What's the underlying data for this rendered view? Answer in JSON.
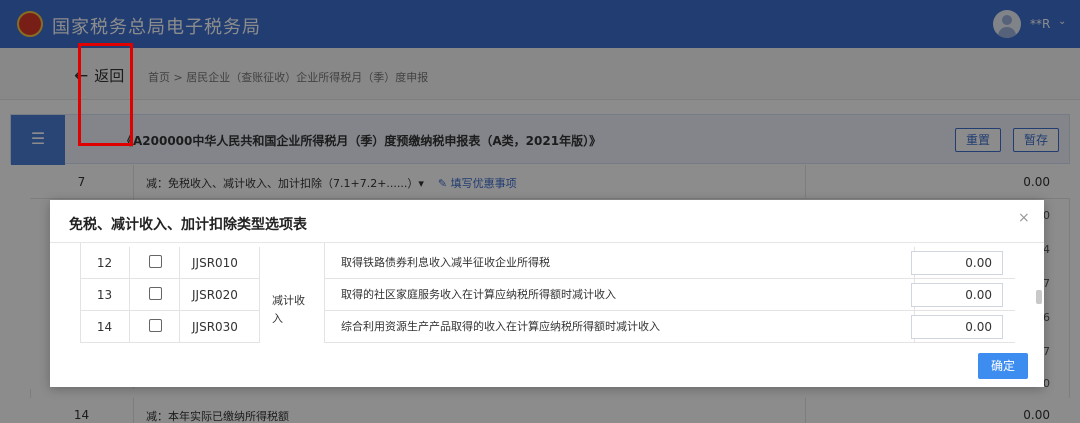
{
  "header": {
    "brand": "国家税务总局电子税务局",
    "user": "**R",
    "logo_icon": "tax-emblem-icon",
    "avatar_icon": "user-avatar-icon",
    "caret": "⌄"
  },
  "subnav": {
    "back_label": "返回",
    "back_icon": "←",
    "breadcrumb": "首页 > 居民企业（查账征收）企业所得税月（季）度申报"
  },
  "form": {
    "menu_icon": "☰",
    "title": "《A200000中华人民共和国企业所得税月（季）度预缴纳税申报表（A类，2021年版）》",
    "reset_label": "重置",
    "save_label": "暂存"
  },
  "background_rows": [
    {
      "no": "7",
      "desc": "减：免税收入、减计收入、加计扣除（7.1+7.2+......）▾",
      "link": "填写优惠事项",
      "value": "0.00"
    },
    {
      "no": "14",
      "desc": "减：本年实际已缴纳所得税额",
      "value": "0.00"
    }
  ],
  "edge_digits": [
    "0",
    "4",
    "7",
    "6",
    "7",
    "0"
  ],
  "modal": {
    "title": "免税、减计收入、加计扣除类型选项表",
    "close_icon": "×",
    "category": "减计收入",
    "rows": [
      {
        "no": "12",
        "code": "JJSR010",
        "name": "取得铁路债券利息收入减半征收企业所得税",
        "amount": "0.00",
        "checked": false
      },
      {
        "no": "13",
        "code": "JJSR020",
        "name": "取得的社区家庭服务收入在计算应纳税所得额时减计收入",
        "amount": "0.00",
        "checked": false
      },
      {
        "no": "14",
        "code": "JJSR030",
        "name": "综合利用资源生产产品取得的收入在计算应纳税所得额时减计收入",
        "amount": "0.00",
        "checked": false
      }
    ],
    "confirm_label": "确定"
  },
  "colors": {
    "brand_blue": "#3d6fd0",
    "highlight_red": "#e00000",
    "confirm_blue": "#3d8cf0"
  }
}
